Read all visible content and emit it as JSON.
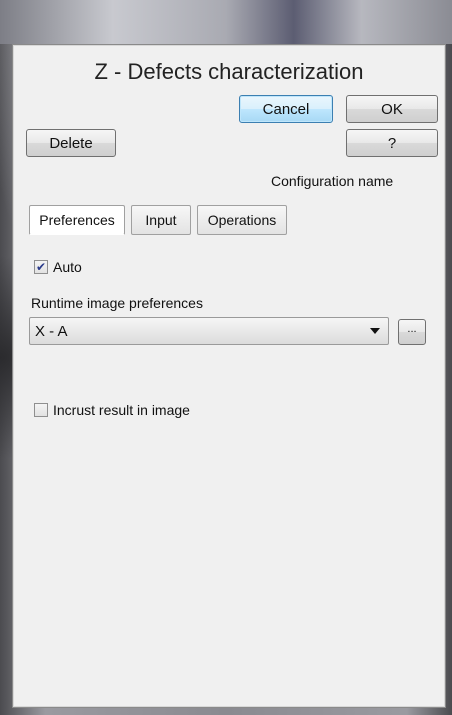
{
  "window": {
    "title": "Z - Defects characterization"
  },
  "buttons": {
    "cancel": "Cancel",
    "ok": "OK",
    "delete": "Delete",
    "help": "?",
    "browse": "..."
  },
  "config_name_label": "Configuration name",
  "tabs": [
    {
      "label": "Preferences",
      "active": true
    },
    {
      "label": "Input",
      "active": false
    },
    {
      "label": "Operations",
      "active": false
    }
  ],
  "auto": {
    "label": "Auto",
    "checked": true
  },
  "runtime": {
    "label": "Runtime image preferences",
    "selected": "X - A"
  },
  "incrust": {
    "label": "Incrust result in image",
    "checked": false
  }
}
